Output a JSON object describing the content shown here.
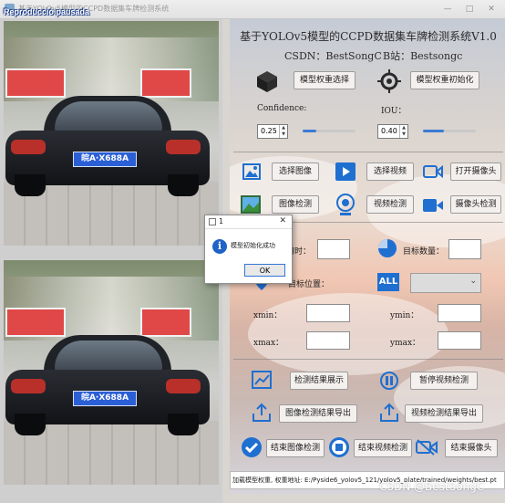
{
  "window": {
    "title": "基于YOLOv5模型的CCPD数据集车牌检测系统",
    "overlay_label": "Reproducció pausada"
  },
  "header": {
    "title": "基于YOLOv5模型的CCPD数据集车牌检测系统V1.0",
    "csdn": "CSDN：BestSongC",
    "bilibili": "B站：Bestsongc"
  },
  "model": {
    "select_weights_label": "模型权重选择",
    "init_weights_label": "模型权重初始化"
  },
  "params": {
    "confidence_label": "Confidence:",
    "confidence_value": "0.25",
    "confidence_fraction": 0.25,
    "iou_label": "IOU：",
    "iou_value": "0.40",
    "iou_fraction": 0.4
  },
  "actions": {
    "select_image": "选择图像",
    "select_video": "选择视频",
    "open_camera": "打开摄像头",
    "detect_image": "图像检测",
    "detect_video": "视频检测",
    "detect_camera": "摄像头检测"
  },
  "results": {
    "time_label": "用时：",
    "count_label": "目标数量：",
    "target_pos_label": "目标位置：",
    "target_select_label": "ALL",
    "xmin_label": "xmin：",
    "ymin_label": "ymin：",
    "xmax_label": "xmax：",
    "ymax_label": "ymax："
  },
  "bottom_actions": {
    "show_results": "检测结果展示",
    "pause_video": "暂停视频检测",
    "export_image": "图像检测结果导出",
    "export_video": "视频检测结果导出",
    "end_image": "结束图像检测",
    "end_video": "结束视频检测",
    "end_camera": "结束摄像头"
  },
  "plates": {
    "top": "皖A·X688A",
    "bottom": "皖A·X688A"
  },
  "dialog": {
    "title": "1",
    "message": "模型初始化成功",
    "ok_label": "OK"
  },
  "status": {
    "text": "加载模型权重, 权重地址: E:/Pyside6_yolov5_121/yolov5_plate/trained/weights/best.pt"
  },
  "watermark": "CSDN @BestSongC",
  "colors": {
    "accent": "#3a7bd5",
    "icon_blue": "#1f6fd1"
  }
}
